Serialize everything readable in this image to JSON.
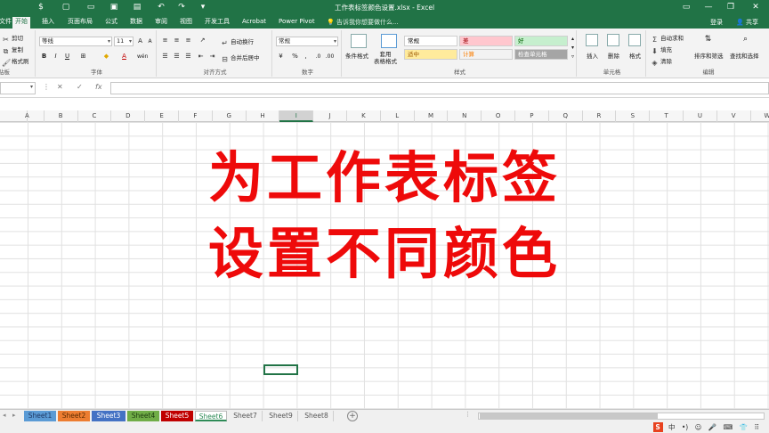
{
  "window": {
    "title": "工作表标签颜色设置.xlsx - Excel",
    "login": "登录"
  },
  "ribbon_tabs": [
    {
      "label": "文件"
    },
    {
      "label": "开始"
    },
    {
      "label": "插入"
    },
    {
      "label": "页面布局"
    },
    {
      "label": "公式"
    },
    {
      "label": "数据"
    },
    {
      "label": "审阅"
    },
    {
      "label": "视图"
    },
    {
      "label": "开发工具"
    },
    {
      "label": "Acrobat"
    },
    {
      "label": "Power Pivot"
    }
  ],
  "active_tab": "开始",
  "tell_me": "告诉我你想要做什么...",
  "share": "共享",
  "clipboard": {
    "cut": "剪切",
    "copy": "复制",
    "format_painter": "格式刷",
    "group": "贴板"
  },
  "font": {
    "name": "等线",
    "size": "11",
    "group": "字体",
    "bold": "B",
    "italic": "I",
    "underline": "U"
  },
  "alignment": {
    "wrap": "自动换行",
    "merge": "合并后居中",
    "group": "对齐方式"
  },
  "number": {
    "format": "常规",
    "percent": "%",
    "group": "数字"
  },
  "styles": {
    "conditional": "条件格式",
    "table_format": "套用\n表格格式",
    "cells": [
      {
        "label": "常规",
        "bg": "#ffffff",
        "color": "#000000"
      },
      {
        "label": "差",
        "bg": "#ffc7ce",
        "color": "#9c0006"
      },
      {
        "label": "好",
        "bg": "#c6efce",
        "color": "#006100"
      },
      {
        "label": "适中",
        "bg": "#ffeb9c",
        "color": "#9c5700"
      },
      {
        "label": "计算",
        "bg": "#f2f2f2",
        "color": "#fa7d00"
      },
      {
        "label": "检查单元格",
        "bg": "#a5a5a5",
        "color": "#ffffff"
      }
    ],
    "group": "样式"
  },
  "cells_group": {
    "insert": "插入",
    "delete": "删除",
    "format": "格式",
    "group": "单元格"
  },
  "editing": {
    "autosum": "自动求和",
    "fill": "填充",
    "clear": "清除",
    "sort": "排序和筛选",
    "find": "查找和选择",
    "group": "编辑"
  },
  "formula_bar": {
    "cancel": "✕",
    "enter": "✓",
    "fx": "fx",
    "content": ""
  },
  "columns": [
    "A",
    "B",
    "C",
    "D",
    "E",
    "F",
    "G",
    "H",
    "I",
    "J",
    "K",
    "L",
    "M",
    "N",
    "O",
    "P",
    "Q",
    "R",
    "S",
    "T",
    "U",
    "V",
    "W"
  ],
  "selected_column": "I",
  "overlay": {
    "line1": "为工作表标签",
    "line2": "设置不同颜色"
  },
  "sheets": [
    {
      "label": "Sheet1",
      "color": "#5b9bd5",
      "text": "#1f3864"
    },
    {
      "label": "Sheet2",
      "color": "#ed7d31",
      "text": "#5a2a00"
    },
    {
      "label": "Sheet3",
      "color": "#4472c4",
      "text": "#ffffff"
    },
    {
      "label": "Sheet4",
      "color": "#70ad47",
      "text": "#1e3d10"
    },
    {
      "label": "Sheet5",
      "color": "#c00000",
      "text": "#ffffff"
    },
    {
      "label": "Sheet6",
      "color": "#ffffff",
      "text": "#2e8b57"
    },
    {
      "label": "Sheet7",
      "color": "",
      "text": "#555555"
    },
    {
      "label": "Sheet9",
      "color": "",
      "text": "#555555"
    },
    {
      "label": "Sheet8",
      "color": "",
      "text": "#555555"
    }
  ],
  "active_sheet": "Sheet6",
  "ime": {
    "logo": "S",
    "lang": "中",
    "items": [
      "•)",
      "☺",
      "🎤",
      "⌨",
      "👕",
      "⠿"
    ]
  }
}
